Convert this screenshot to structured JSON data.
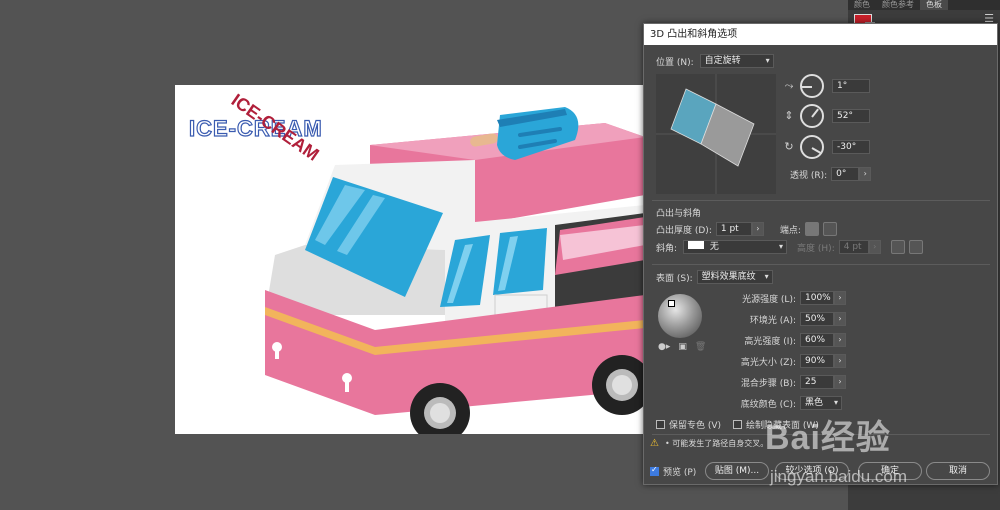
{
  "panel": {
    "tabs": [
      "颜色",
      "颜色参考",
      "色板"
    ],
    "menu_icon": "hamburger-icon"
  },
  "artboard": {
    "logo_text_1": "ICE-CREAM",
    "logo_text_2": "ICE-CREAM"
  },
  "dialog": {
    "title": "3D 凸出和斜角选项",
    "position_label": "位置 (N):",
    "position_value": "自定旋转",
    "rot_x": "1°",
    "rot_y": "52°",
    "rot_z": "-30°",
    "perspective_label": "透视 (R):",
    "perspective_value": "0°",
    "extrude_section": "凸出与斜角",
    "extrude_depth_label": "凸出厚度 (D):",
    "extrude_depth_value": "1 pt",
    "cap_label": "端点:",
    "bevel_label": "斜角:",
    "bevel_value": "无",
    "height_label": "高度 (H):",
    "height_value": "4 pt",
    "surface_label": "表面 (S):",
    "surface_value": "塑料效果底纹",
    "light_intensity_label": "光源强度 (L):",
    "light_intensity_value": "100%",
    "ambient_label": "环境光 (A):",
    "ambient_value": "50%",
    "highlight_intensity_label": "高光强度 (I):",
    "highlight_intensity_value": "60%",
    "highlight_size_label": "高光大小 (Z):",
    "highlight_size_value": "90%",
    "blend_steps_label": "混合步骤 (B):",
    "blend_steps_value": "25",
    "shading_color_label": "底纹颜色 (C):",
    "shading_color_value": "黑色",
    "preserve_spot_label": "保留专色 (V)",
    "draw_hidden_label": "绘制隐藏表面 (W)",
    "warning_text": "• 可能发生了路径自身交叉。",
    "preview_label": "预览 (P)",
    "map_button": "贴图 (M)...",
    "fewer_options_button": "较少选项 (O)",
    "ok_button": "确定",
    "cancel_button": "取消"
  },
  "watermark": {
    "brand": "Bai经验",
    "url": "jingyan.baidu.com"
  },
  "colors": {
    "pink": "#e8769c",
    "pink_dark": "#c9547c",
    "roof_pink": "#f0a0bc",
    "white_body": "#f2f2f2",
    "window_blue": "#2aa6d8",
    "stripe_orange": "#f2b45c",
    "popsicle_blue": "#2f8fd0",
    "dialog_bg": "#474747"
  }
}
